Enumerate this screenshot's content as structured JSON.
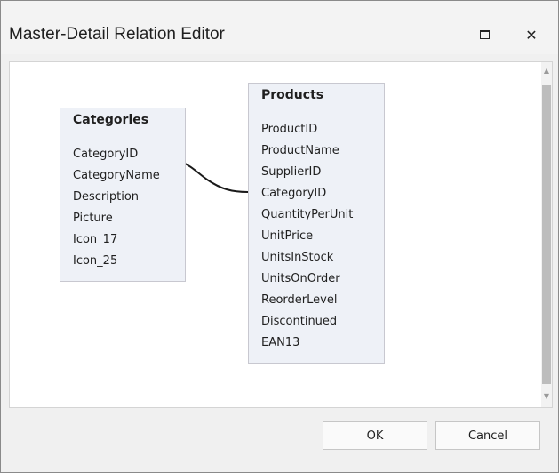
{
  "window": {
    "title": "Master-Detail Relation Editor",
    "maximize_icon": "maximize-icon",
    "close_icon": "close-icon",
    "close_glyph": "✕"
  },
  "categories": {
    "name": "Categories",
    "fields": [
      "CategoryID",
      "CategoryName",
      "Description",
      "Picture",
      "Icon_17",
      "Icon_25"
    ]
  },
  "products": {
    "name": "Products",
    "fields": [
      "ProductID",
      "ProductName",
      "SupplierID",
      "CategoryID",
      "QuantityPerUnit",
      "UnitPrice",
      "UnitsInStock",
      "UnitsOnOrder",
      "ReorderLevel",
      "Discontinued",
      "EAN13"
    ]
  },
  "relation": {
    "from": "Categories.CategoryID",
    "to": "Products.CategoryID"
  },
  "scrollbar": {
    "up_glyph": "▲",
    "down_glyph": "▼"
  },
  "buttons": {
    "ok": "OK",
    "cancel": "Cancel"
  },
  "colors": {
    "table_fill": "#eef1f7",
    "connector": "#1a1a1a"
  }
}
